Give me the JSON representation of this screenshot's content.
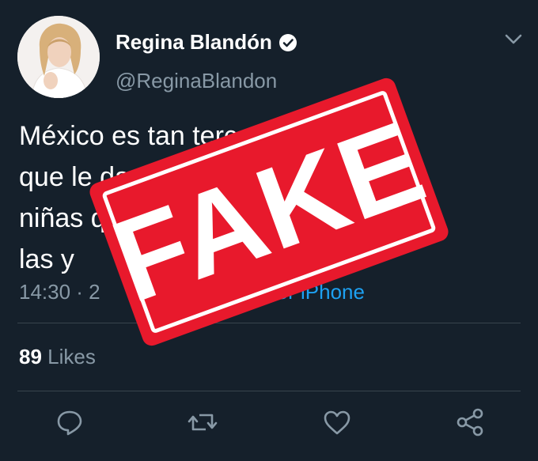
{
  "user": {
    "display_name": "Regina Blandón",
    "handle": "@ReginaBlandon"
  },
  "tweet": {
    "lines": [
      "México es tan tercermundista,",
      "que le dan más importancia a las",
      "niñas que se van a cuidar que a",
      "las y"
    ],
    "time": "14:30 · 2",
    "source": "Twitter for iPhone"
  },
  "stats": {
    "likes_count": "89",
    "likes_label": "Likes"
  },
  "stamp": {
    "text": "FAKE",
    "color": "#e8192c"
  },
  "icons": {
    "avatar": "avatar",
    "verified": "verified-badge-icon",
    "menu": "chevron-down-icon",
    "reply": "reply-icon",
    "retweet": "retweet-icon",
    "like": "heart-icon",
    "share": "share-icon"
  },
  "colors": {
    "background": "#15202b",
    "secondary_text": "#8899a6",
    "link": "#1da1f2"
  }
}
